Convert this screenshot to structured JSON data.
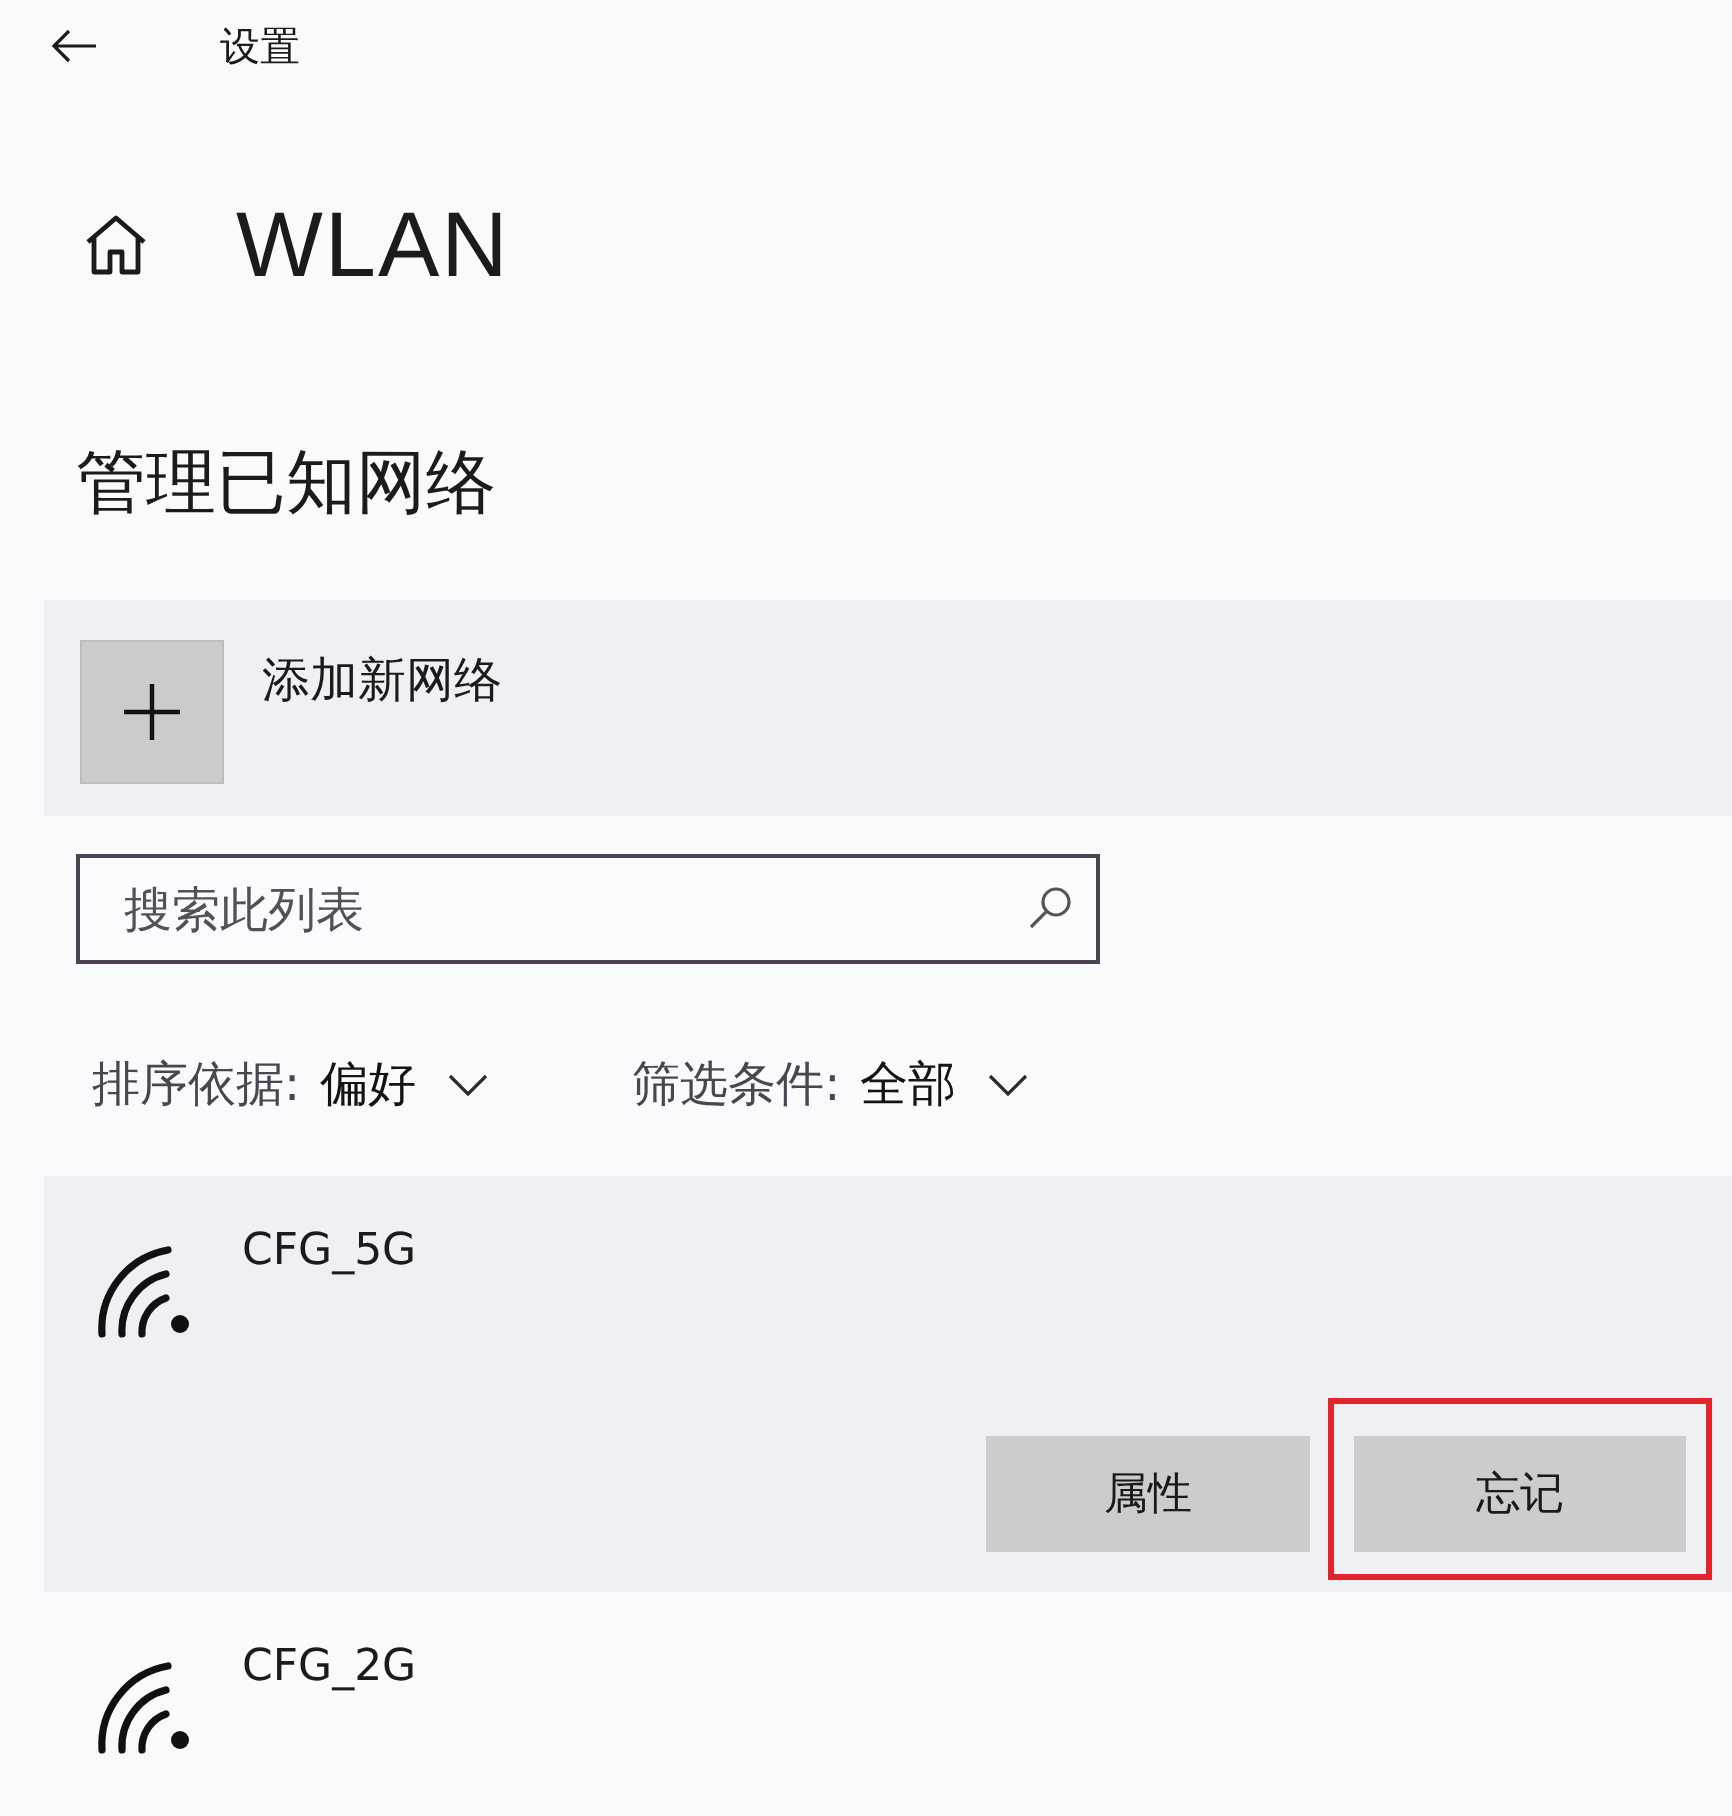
{
  "header": {
    "title": "设置"
  },
  "page": {
    "title": "WLAN"
  },
  "section": {
    "title": "管理已知网络"
  },
  "add_network": {
    "label": "添加新网络"
  },
  "search": {
    "placeholder": "搜索此列表"
  },
  "sort": {
    "label": "排序依据:",
    "value": "偏好"
  },
  "filter": {
    "label": "筛选条件:",
    "value": "全部"
  },
  "networks": [
    {
      "name": "CFG_5G",
      "selected": true,
      "buttons": [
        {
          "label": "属性",
          "highlighted": false
        },
        {
          "label": "忘记",
          "highlighted": true
        }
      ]
    },
    {
      "name": "CFG_2G",
      "selected": false
    }
  ]
}
